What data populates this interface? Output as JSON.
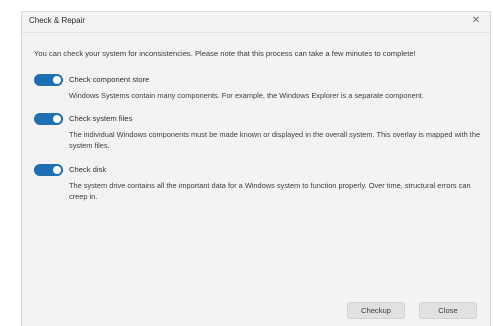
{
  "dialog": {
    "title": "Check & Repair",
    "close_glyph": "✕",
    "intro": "You can check your system for inconsistencies. Please note that this process can take a few minutes to complete!"
  },
  "options": [
    {
      "title": "Check component store",
      "description": "Windows Systems contain many components. For example, the Windows Explorer is a separate component.",
      "enabled": true
    },
    {
      "title": "Check system files",
      "description": "The individual Windows components must be made known or displayed in the overall system. This overlay is mapped with the system files.",
      "enabled": true
    },
    {
      "title": "Check disk",
      "description": "The system drive contains all the important data for a Windows system to function properly. Over time, structural errors can creep in.",
      "enabled": true
    }
  ],
  "buttons": {
    "checkup": "Checkup",
    "close": "Close"
  },
  "colors": {
    "toggle_on": "#1f6fb2",
    "dialog_bg": "#f3f3f3"
  }
}
